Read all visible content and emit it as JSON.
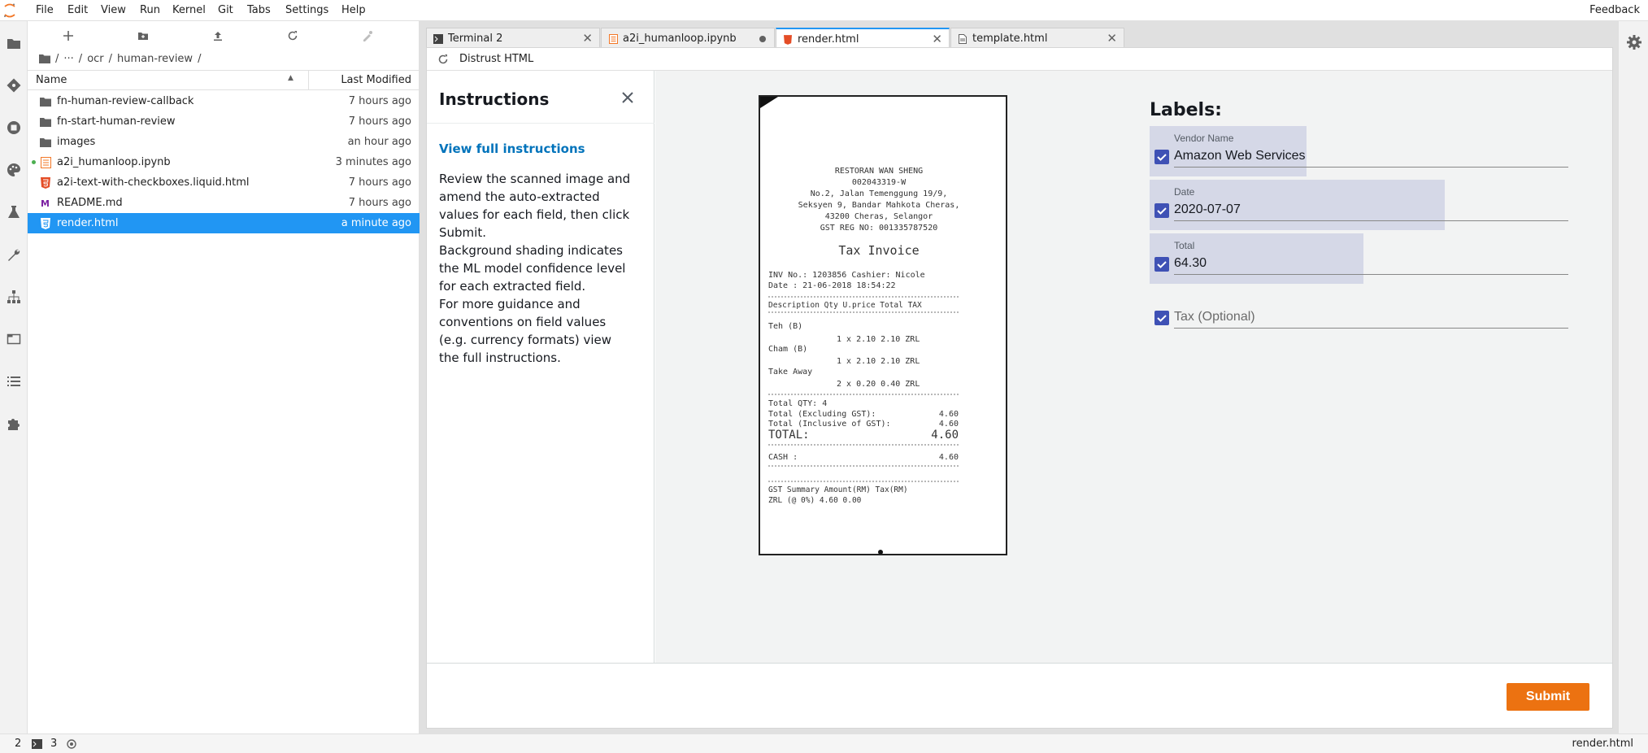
{
  "menubar": {
    "items": [
      "File",
      "Edit",
      "View",
      "Run",
      "Kernel",
      "Git",
      "Tabs",
      "Settings",
      "Help"
    ],
    "feedback": "Feedback"
  },
  "activity_icons": [
    "folder-icon",
    "git-icon",
    "running-icon",
    "palette-icon",
    "flask-icon",
    "wrench-icon",
    "network-icon",
    "tab-window-icon",
    "list-icon",
    "extension-icon"
  ],
  "filebrowser": {
    "breadcrumb": [
      "/",
      "···",
      "/",
      "ocr",
      "/",
      "human-review",
      "/"
    ],
    "col_name": "Name",
    "col_modified": "Last Modified",
    "files": [
      {
        "name": "fn-human-review-callback",
        "modified": "7 hours ago",
        "icon": "folder-icon"
      },
      {
        "name": "fn-start-human-review",
        "modified": "7 hours ago",
        "icon": "folder-icon"
      },
      {
        "name": "images",
        "modified": "an hour ago",
        "icon": "folder-icon"
      },
      {
        "name": "a2i_humanloop.ipynb",
        "modified": "3 minutes ago",
        "icon": "notebook-icon",
        "running": true
      },
      {
        "name": "a2i-text-with-checkboxes.liquid.html",
        "modified": "7 hours ago",
        "icon": "html-icon"
      },
      {
        "name": "README.md",
        "modified": "7 hours ago",
        "icon": "markdown-icon"
      },
      {
        "name": "render.html",
        "modified": "a minute ago",
        "icon": "html-icon",
        "selected": true
      }
    ]
  },
  "tabs": [
    {
      "label": "Terminal 2",
      "icon": "terminal-icon"
    },
    {
      "label": "a2i_humanloop.ipynb",
      "icon": "notebook-icon",
      "dirty": true
    },
    {
      "label": "render.html",
      "icon": "html-icon",
      "active": true
    },
    {
      "label": "template.html",
      "icon": "file-icon"
    }
  ],
  "doc_toolbar": {
    "distrust": "Distrust HTML"
  },
  "instructions": {
    "title": "Instructions",
    "link": "View full instructions",
    "paragraphs": [
      "Review the scanned image and amend the auto-extracted values for each field, then click Submit.",
      "Background shading indicates the ML model confidence level for each extracted field.",
      "For more guidance and conventions on field values (e.g. currency formats) view the full instructions."
    ]
  },
  "receipt": {
    "header": [
      "RESTORAN WAN SHENG",
      "002043319-W",
      "No.2, Jalan Temenggung 19/9,",
      "Seksyen 9, Bandar Mahkota Cheras,",
      "43200 Cheras, Selangor",
      "GST REG NO: 001335787520"
    ],
    "title": "Tax Invoice",
    "inv": "INV No.: 1203856  Cashier: Nicole",
    "date": "Date   : 21-06-2018 18:54:22",
    "table_header": "Description    Qty    U.price  Total TAX",
    "items": [
      {
        "desc": "Teh (B)",
        "line": "1 x     2.10      2.10 ZRL"
      },
      {
        "desc": "Cham (B)",
        "line": "1 x     2.10      2.10 ZRL"
      },
      {
        "desc": "Take Away",
        "line": "2 x     0.20      0.40 ZRL"
      }
    ],
    "total_qty": "Total QTY: 4",
    "excl": "Total (Excluding GST):",
    "excl_val": "4.60",
    "incl": "Total (Inclusive of GST):",
    "incl_val": "4.60",
    "total": "TOTAL:",
    "total_val": "4.60",
    "cash": "CASH :",
    "cash_val": "4.60",
    "gst_header": "GST Summary      Amount(RM)   Tax(RM)",
    "gst_row": "ZRL       (@ 0%)        4.60      0.00"
  },
  "labels": {
    "title": "Labels:",
    "fields": [
      {
        "label": "Vendor Name",
        "value": "Amazon Web Services",
        "checked": true,
        "confidence": 0.33
      },
      {
        "label": "Date",
        "value": "2020-07-07",
        "checked": true,
        "confidence": 0.62
      },
      {
        "label": "Total",
        "value": "64.30",
        "checked": true,
        "confidence": 0.45
      },
      {
        "label": "",
        "placeholder": "Tax (Optional)",
        "value": "",
        "checked": true,
        "confidence": 0
      }
    ]
  },
  "submit_label": "Submit",
  "statusbar": {
    "kernels": "2",
    "terminals": "3",
    "filename": "render.html"
  },
  "colors": {
    "accent": "#2196f3",
    "submit": "#ec7211",
    "checkbox": "#3f51b5",
    "link": "#0073bb"
  }
}
